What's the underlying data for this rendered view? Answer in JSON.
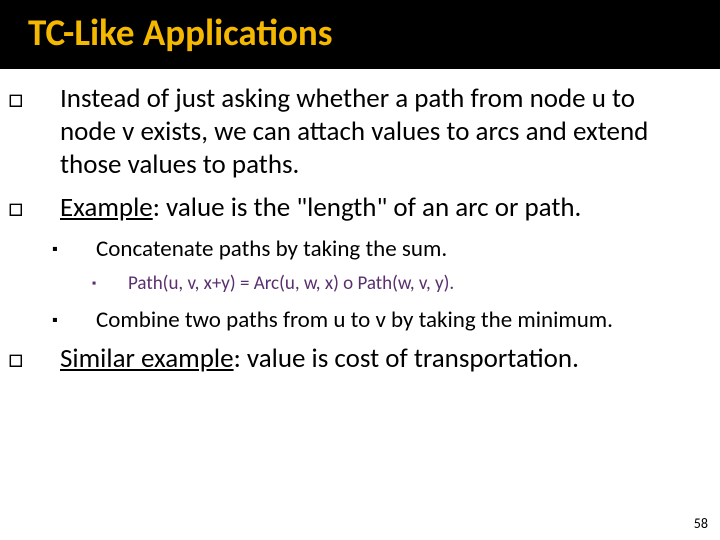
{
  "title": "TC-Like Applications",
  "b1_1_a": "Instead of just asking whether a path from node u to node v exists, we can attach values to arcs and extend those values to paths.",
  "b1_2_label": "Example",
  "b1_2_rest": ": value is the \"length\" of an arc or path.",
  "b2_1": "Concatenate paths by taking the sum.",
  "b3_1": "Path(u, v, x+y) = Arc(u, w, x) o Path(w, v, y).",
  "b2_2": "Combine two paths from u to v by taking the minimum.",
  "b1_3_label": "Similar example",
  "b1_3_rest": ": value is cost of transportation.",
  "pagenum": "58"
}
